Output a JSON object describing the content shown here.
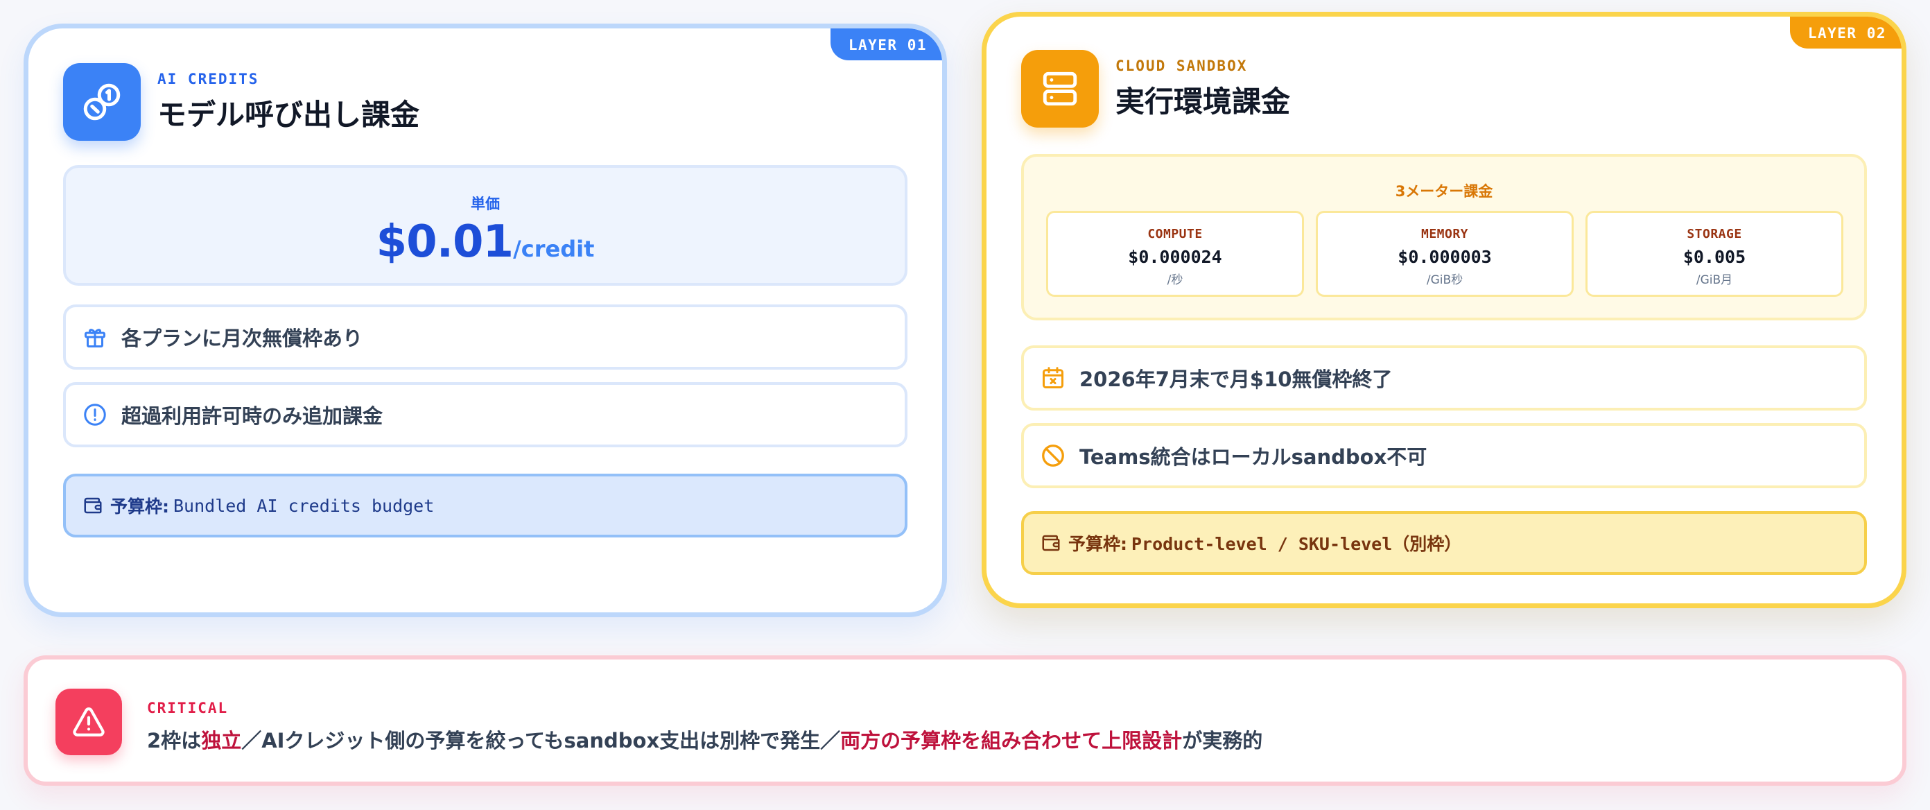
{
  "layer1": {
    "tag": "LAYER 01",
    "kicker": "AI CREDITS",
    "title": "モデル呼び出し課金",
    "price_label": "単価",
    "price_amount": "$0.01",
    "price_unit": "/credit",
    "rows": [
      {
        "icon": "gift-icon",
        "text": "各プランに月次無償枠あり"
      },
      {
        "icon": "alert-circle-icon",
        "text": "超過利用許可時のみ追加課金"
      }
    ],
    "budget_key": "予算枠:",
    "budget_value": "Bundled AI credits budget",
    "accent": "#3b82f6"
  },
  "layer2": {
    "tag": "LAYER 02",
    "kicker": "CLOUD SANDBOX",
    "title": "実行環境課金",
    "meter_title": "3メーター課金",
    "meters": [
      {
        "name": "COMPUTE",
        "price": "$0.000024",
        "unit": "/秒"
      },
      {
        "name": "MEMORY",
        "price": "$0.000003",
        "unit": "/GiB秒"
      },
      {
        "name": "STORAGE",
        "price": "$0.005",
        "unit": "/GiB月"
      }
    ],
    "rows": [
      {
        "icon": "calendar-x-icon",
        "text": "2026年7月末で月$10無償枠終了"
      },
      {
        "icon": "ban-icon",
        "text": "Teams統合はローカルsandbox不可"
      }
    ],
    "budget_key": "予算枠:",
    "budget_value": "Product-level / SKU-level（別枠）",
    "accent": "#f59e0b"
  },
  "critical": {
    "kicker": "CRITICAL",
    "text_1": "2枠は",
    "em_1": "独立",
    "text_2": "／AIクレジット側の予算を絞ってもsandbox支出は別枠で発生／",
    "em_2": "両方の予算枠を組み合わせて上限設計",
    "text_3": "が実務的",
    "accent": "#f43f5e"
  }
}
